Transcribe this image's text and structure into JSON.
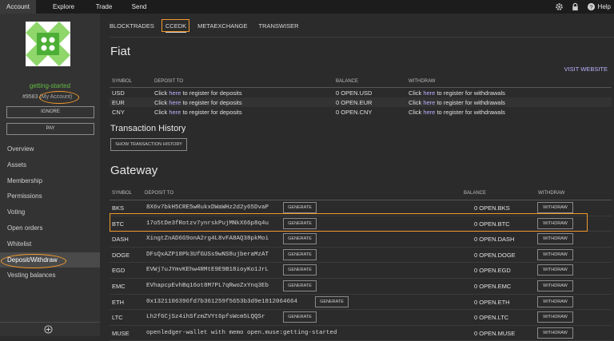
{
  "topnav": {
    "items": [
      {
        "label": "Account"
      },
      {
        "label": "Explore"
      },
      {
        "label": "Trade"
      },
      {
        "label": "Send"
      }
    ],
    "help_label": "Help",
    "icons": [
      "gear-icon",
      "lock-icon",
      "help-icon"
    ]
  },
  "sidebar": {
    "account_name": "getting-started",
    "account_id": "#9583",
    "my_account": "(My Account)",
    "ignore_label": "IGNORE",
    "pay_label": "PAY",
    "menu": [
      {
        "label": "Overview"
      },
      {
        "label": "Assets"
      },
      {
        "label": "Membership"
      },
      {
        "label": "Permissions"
      },
      {
        "label": "Voting"
      },
      {
        "label": "Open orders"
      },
      {
        "label": "Whitelist"
      },
      {
        "label": "Deposit/Withdraw"
      },
      {
        "label": "Vesting balances"
      }
    ],
    "active_item": "Deposit/Withdraw",
    "identicon_color": "#66bb44"
  },
  "tabs": [
    {
      "label": "BLOCKTRADES"
    },
    {
      "label": "CCEDK"
    },
    {
      "label": "METAEXCHANGE"
    },
    {
      "label": "TRANSWISER"
    }
  ],
  "active_tab": "CCEDK",
  "fiat": {
    "title": "Fiat",
    "visit_label": "VISIT WEBSITE",
    "headers": {
      "symbol": "SYMBOL",
      "deposit": "DEPOSIT TO",
      "balance": "BALANCE",
      "withdraw": "WITHDRAW"
    },
    "rows": [
      {
        "symbol": "USD",
        "dep_pre": "Click ",
        "dep_link": "here",
        "dep_post": " to register for deposits",
        "balance": "0 OPEN.USD",
        "wd_pre": "Click ",
        "wd_link": "here",
        "wd_post": " to register for withdrawals"
      },
      {
        "symbol": "EUR",
        "dep_pre": "Click ",
        "dep_link": "here",
        "dep_post": " to register for deposits",
        "balance": "0 OPEN.EUR",
        "wd_pre": "Click ",
        "wd_link": "here",
        "wd_post": " to register for withdrawals"
      },
      {
        "symbol": "CNY",
        "dep_pre": "Click ",
        "dep_link": "here",
        "dep_post": " to register for deposits",
        "balance": "0 OPEN.CNY",
        "wd_pre": "Click ",
        "wd_link": "here",
        "wd_post": " to register for withdrawals"
      }
    ]
  },
  "tx_history": {
    "title": "Transaction History",
    "button_label": "SHOW TRANSACTION HISTORY"
  },
  "gateway": {
    "title": "Gateway",
    "headers": {
      "symbol": "SYMBOL",
      "deposit": "DEPOSIT TO",
      "balance": "BALANCE",
      "withdraw": "WITHDRAW"
    },
    "generate_label": "GENERATE",
    "withdraw_label": "WITHDRAW",
    "rows": [
      {
        "symbol": "BKS",
        "address": "8X6v7bkH5CRE5wRukxDWaWHz2d2y65DvaP",
        "balance": "0 OPEN.BKS"
      },
      {
        "symbol": "BTC",
        "address": "17o5tDe3fRotzv7ynrskPujMNkX66p8q4u",
        "balance": "0 OPEN.BTC"
      },
      {
        "symbol": "DASH",
        "address": "XingtZnAD6G9onA2rg4L8vFA8AQ38pkMoi",
        "balance": "0 OPEN.DASH"
      },
      {
        "symbol": "DOGE",
        "address": "DFsQxAZP18Pk3UfGUSs9wNS8ujberaMzAT",
        "balance": "0 OPEN.DOGE"
      },
      {
        "symbol": "EGD",
        "address": "EVWj7uJYmvKEhw4RMtE9E9B18ioyKo1JrL",
        "balance": "0 OPEN.EGD"
      },
      {
        "symbol": "EMC",
        "address": "EVhapcpEvhBq16ot8M7PL7qRwoZxYnq3Eb",
        "balance": "0 OPEN.EMC"
      },
      {
        "symbol": "ETH",
        "address": "0x1321106396fd7b361259f5653b3d9e1812064664",
        "balance": "0 OPEN.ETH"
      },
      {
        "symbol": "LTC",
        "address": "Lh2f6CjSz4ihSfzmZVYt6pfsWcm5LQQSr",
        "balance": "0 OPEN.LTC"
      },
      {
        "symbol": "MUSE",
        "address": "openledger-wallet   with memo open.muse:getting-started",
        "balance": "0 OPEN.MUSE"
      }
    ]
  },
  "colors": {
    "highlight": "#f29a2e",
    "link": "#b9b2ff",
    "account_name": "#66bb44"
  }
}
